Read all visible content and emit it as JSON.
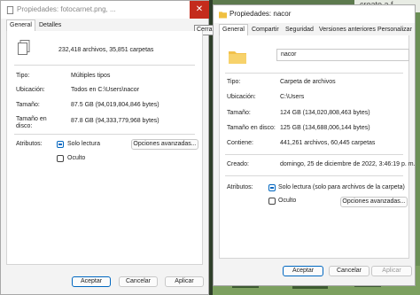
{
  "background": {
    "corner_text": "create a f"
  },
  "left_window": {
    "title": "Propiedades: fotocarnet.png, ...",
    "tooltip": "Cerrar",
    "tabs": [
      "General",
      "Detalles"
    ],
    "summary": "232,418 archivos, 35,851 carpetas",
    "rows": [
      {
        "label": "Tipo:",
        "value": "Múltiples tipos"
      },
      {
        "label": "Ubicación:",
        "value": "Todos en C:\\Users\\nacor"
      },
      {
        "label": "Tamaño:",
        "value": "87.5 GB (94,019,804,846 bytes)"
      },
      {
        "label": "Tamaño en disco:",
        "value": "87.8 GB (94,333,779,968 bytes)"
      }
    ],
    "attributes_label": "Atributos:",
    "readonly_label": "Solo lectura",
    "hidden_label": "Oculto",
    "advanced_button": "Opciones avanzadas...",
    "buttons": [
      "Aceptar",
      "Cancelar",
      "Aplicar"
    ]
  },
  "right_window": {
    "title": "Propiedades: nacor",
    "tabs": [
      "General",
      "Compartir",
      "Seguridad",
      "Versiones anteriores",
      "Personalizar"
    ],
    "folder_name": "nacor",
    "rows_a": [
      {
        "label": "Tipo:",
        "value": "Carpeta de archivos"
      },
      {
        "label": "Ubicación:",
        "value": "C:\\Users"
      }
    ],
    "rows_b": [
      {
        "label": "Tamaño:",
        "value": "124 GB (134,020,808,463 bytes)"
      },
      {
        "label": "Tamaño en disco:",
        "value": "125 GB (134,688,006,144 bytes)"
      },
      {
        "label": "Contiene:",
        "value": "441,261 archivos, 60,445 carpetas"
      }
    ],
    "created_label": "Creado:",
    "created_value": "domingo, 25 de diciembre de 2022, 3:46:19 p. m.",
    "attributes_label": "Atributos:",
    "readonly_label": "Solo lectura (solo para archivos de la carpeta)",
    "hidden_label": "Oculto",
    "advanced_button": "Opciones avanzadas...",
    "buttons": [
      "Aceptar",
      "Cancelar",
      "Aplicar"
    ]
  }
}
